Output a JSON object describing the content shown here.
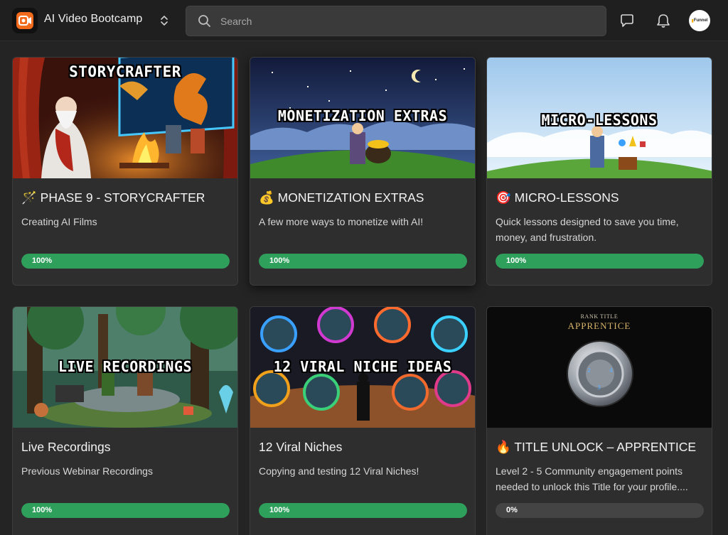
{
  "header": {
    "app_title": "AI Video Bootcamp",
    "search_placeholder": "Search",
    "avatar_text": "Funnel",
    "icons": [
      "app-logo-icon",
      "chevron-updown-icon",
      "search-icon",
      "chat-icon",
      "bell-icon"
    ]
  },
  "colors": {
    "background": "#242424",
    "card": "#2e2e2e",
    "progress_fill": "#2ea05c",
    "progress_track": "#444444",
    "accent_orange": "#f26a1b"
  },
  "courses": [
    {
      "thumb_label": "STORYCRAFTER",
      "emoji": "🪄",
      "title": "PHASE 9 - STORYCRAFTER",
      "description": "Creating AI Films",
      "progress": 100,
      "progress_label": "100%"
    },
    {
      "thumb_label": "MONETIZATION EXTRAS",
      "emoji": "💰",
      "title": "MONETIZATION EXTRAS",
      "description": "A few more ways to monetize with AI!",
      "progress": 100,
      "progress_label": "100%"
    },
    {
      "thumb_label": "MICRO-LESSONS",
      "emoji": "🎯",
      "title": "MICRO-LESSONS",
      "description": "Quick lessons designed to save you time, money, and frustration.",
      "progress": 100,
      "progress_label": "100%"
    },
    {
      "thumb_label": "LIVE RECORDINGS",
      "emoji": "",
      "title": "Live Recordings",
      "description": "Previous Webinar Recordings",
      "progress": 100,
      "progress_label": "100%"
    },
    {
      "thumb_label": "12 VIRAL NICHE IDEAS",
      "emoji": "",
      "title": "12 Viral Niches",
      "description": "Copying and testing 12 Viral Niches!",
      "progress": 100,
      "progress_label": "100%"
    },
    {
      "thumb_label_small": "RANK TITLE",
      "thumb_label": "APPRENTICE",
      "emoji": "🔥",
      "title": "TITLE UNLOCK – APPRENTICE",
      "description": "Level 2 - 5 Community engagement points needed to unlock this Title for your profile....",
      "progress": 0,
      "progress_label": "0%"
    }
  ]
}
